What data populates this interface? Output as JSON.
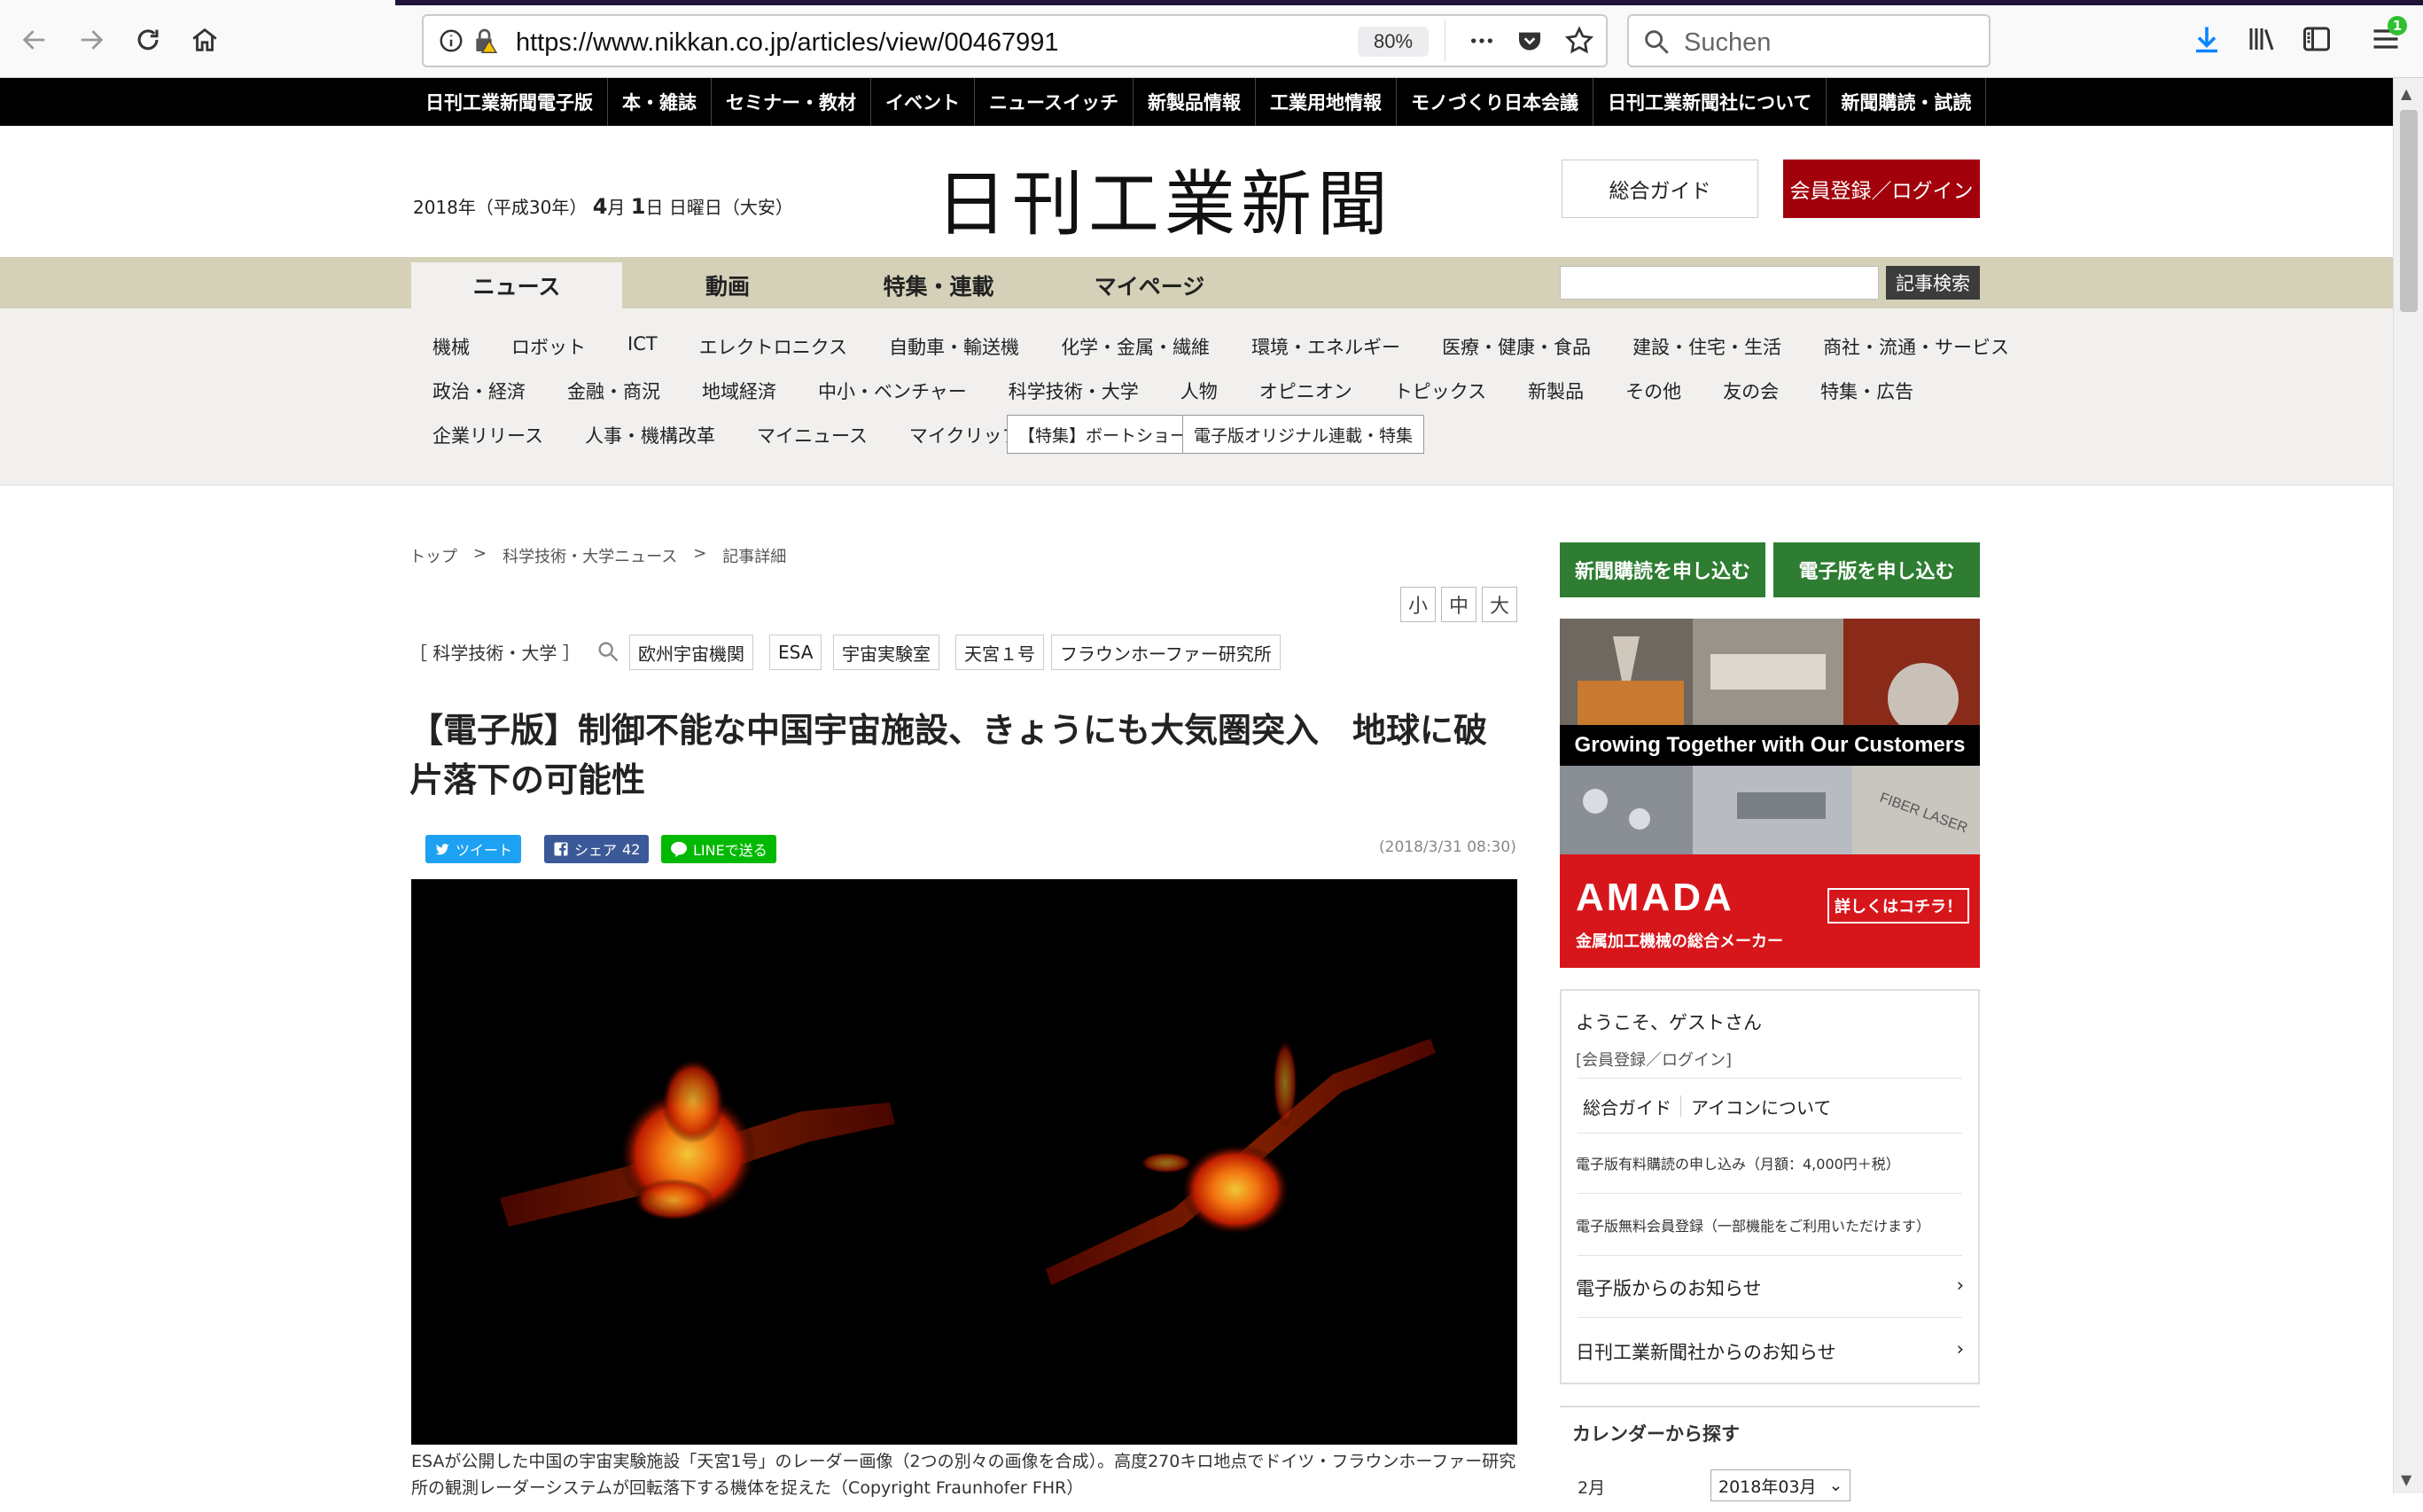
{
  "browser": {
    "url": "https://www.nikkan.co.jp/articles/view/00467991",
    "zoom": "80%",
    "search_placeholder": "Suchen",
    "badge": "1"
  },
  "topnav": [
    "日刊工業新聞電子版",
    "本・雑誌",
    "セミナー・教材",
    "イベント",
    "ニュースイッチ",
    "新製品情報",
    "工業用地情報",
    "モノづくり日本会議",
    "日刊工業新聞社について",
    "新聞購読・試読"
  ],
  "masthead": {
    "date_prefix": "2018年（平成30年）",
    "date_month": "4",
    "date_month_unit": "月",
    "date_day": "1",
    "date_suffix": "日 日曜日（大安）",
    "logo": "日刊工業新聞",
    "guide": "総合ガイド",
    "login": "会員登録／ログイン"
  },
  "main_tabs": [
    "ニュース",
    "動画",
    "特集・連載",
    "マイページ"
  ],
  "keyword_search_button": "記事検索",
  "categories": {
    "row1": [
      "機械",
      "ロボット",
      "ICT",
      "エレクトロニクス",
      "自動車・輸送機",
      "化学・金属・繊維",
      "環境・エネルギー",
      "医療・健康・食品",
      "建設・住宅・生活",
      "商社・流通・サービス"
    ],
    "row2": [
      "政治・経済",
      "金融・商況",
      "地域経済",
      "中小・ベンチャー",
      "科学技術・大学",
      "人物",
      "オピニオン",
      "トピックス",
      "新製品",
      "その他",
      "友の会",
      "特集・広告"
    ],
    "row3": [
      "企業リリース",
      "人事・機構改革",
      "マイニュース",
      "マイクリップ"
    ],
    "boxed": [
      "【特集】ボートショー",
      "電子版オリジナル連載・特集"
    ]
  },
  "breadcrumb": [
    "トップ",
    ">",
    "科学技術・大学ニュース",
    ">",
    "記事詳細"
  ],
  "font_sizes": [
    "小",
    "中",
    "大"
  ],
  "article": {
    "category": "［ 科学技術・大学 ］",
    "tags": [
      "欧州宇宙機関",
      "ESA",
      "宇宙実験室",
      "天宮１号",
      "フラウンホーファー研究所"
    ],
    "headline": "【電子版】制御不能な中国宇宙施設、きょうにも大気圏突入　地球に破片落下の可能性",
    "share": {
      "tweet": "ツイート",
      "facebook": "シェア",
      "facebook_count": "42",
      "line": "LINEで送る"
    },
    "published": "(2018/3/31 08:30)",
    "caption": "ESAが公開した中国の宇宙実験施設「天宮1号」のレーダー画像（2つの別々の画像を合成）。高度270キロ地点でドイツ・フラウンホーファー研究所の観測レーダーシステムが回転落下する機体を捉えた（Copyright Fraunhofer FHR）"
  },
  "sidebar": {
    "subscribe_paper": "新聞購読を申し込む",
    "subscribe_digital": "電子版を申し込む",
    "ad": {
      "tagline": "Growing Together with Our Customers",
      "brand": "AMADA",
      "sub": "金属加工機械の総合メーカー",
      "cta": "詳しくはコチラ！",
      "laser_label": "FIBER LASER"
    },
    "member": {
      "welcome": "ようこそ、ゲストさん",
      "register_link": "[会員登録／ログイン]",
      "guide": "総合ガイド",
      "icon_about": "アイコンについて",
      "paid": "電子版有料購読の申し込み（月額：4,000円＋税）",
      "free": "電子版無料会員登録（一部機能をご利用いただけます）",
      "notice_digital": "電子版からのお知らせ",
      "notice_company": "日刊工業新聞社からのお知らせ"
    },
    "calendar": {
      "title": "カレンダーから探す",
      "month": "2月",
      "select": "2018年03月"
    }
  }
}
